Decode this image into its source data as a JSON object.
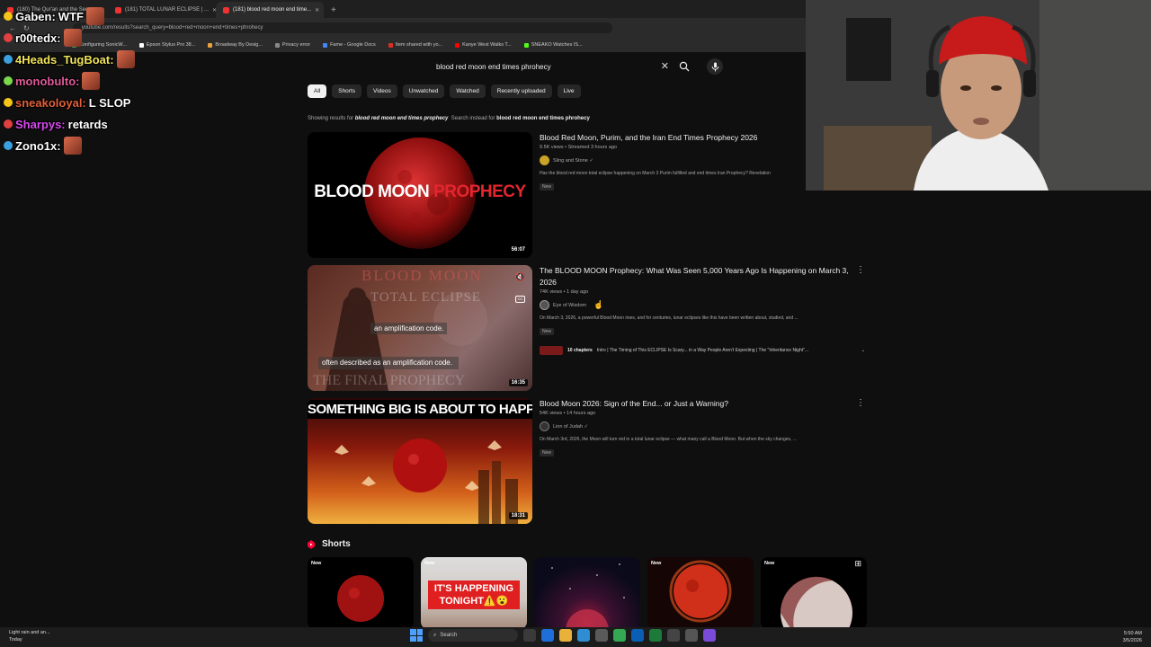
{
  "browser": {
    "tabs": [
      {
        "label": "(180) The Qur'an and the Sec..."
      },
      {
        "label": "(181) TOTAL LUNAR ECLIPSE | ..."
      },
      {
        "label": "(181) blood red moon end time..."
      }
    ],
    "new_tab": "+",
    "url": "youtube.com/results?search_query=blood+red+moon+end+times+phrohecy",
    "bookmarks": [
      {
        "label": "Configuring SonicW...",
        "color": "#2da44e"
      },
      {
        "label": "Epson Stylus Pro 38...",
        "color": "#ffffff"
      },
      {
        "label": "Broadway By Desig...",
        "color": "#e8a23b"
      },
      {
        "label": "Privacy error",
        "color": "#888888"
      },
      {
        "label": "Fame - Google Docs",
        "color": "#4285f4"
      },
      {
        "label": "Item shared with yo...",
        "color": "#d93025"
      },
      {
        "label": "Kanye West Walks T...",
        "color": "#ff0000"
      },
      {
        "label": "SNEAKO Watches IS...",
        "color": "#53fc18"
      }
    ]
  },
  "youtube": {
    "search_value": "blood red moon end times phrohecy",
    "clear_glyph": "✕",
    "chips": [
      "All",
      "Shorts",
      "Videos",
      "Unwatched",
      "Watched",
      "Recently uploaded",
      "Live"
    ],
    "showing_prefix": "Showing results for",
    "showing_query": "blood red moon end times prophecy",
    "instead_prefix": "Search instead for",
    "instead_query": "blood red moon end times phrohecy",
    "results": [
      {
        "title": "Blood Red Moon, Purim, and the Iran End Times Prophecy 2026",
        "meta": "9.5K views • Streamed 3 hours ago",
        "channel": "Sling and Stone ✓",
        "description": "Has the blood red moon total eclipse happening on March 3 Purim fulfilled and end times Iran Prophecy? Revelation",
        "badge": "New",
        "duration": "56:07",
        "thumb_text_1": "BLOOD MOON",
        "thumb_text_2": "PROPHECY"
      },
      {
        "title": "The BLOOD MOON Prophecy: What Was Seen 5,000 Years Ago Is Happening on March 3, 2026",
        "meta": "74K views • 1 day ago",
        "channel": "Eye of Wisdom",
        "description": "On March 3, 2026, a powerful Blood Moon rises, and for centuries, lunar eclipses like this have been written about, studied, and ...",
        "badge": "New",
        "duration": "16:35",
        "caption_1": "an amplification code.",
        "caption_2": "often described as an amplification code.",
        "chapters_label": "10 chapters",
        "chapters_text": "Intro | The Timing of This ECLIPSE Is Scary... in a Way People Aren't Expecting | The \"Inheritance Night\"...",
        "thumb_overlay_1": "TOTAL ECLIPSE",
        "thumb_overlay_2": "THE FINAL PROPHECY",
        "thumb_overlay_3": "BLOOD MOON"
      },
      {
        "title": "Blood Moon 2026: Sign of the End... or Just a Warning?",
        "meta": "54K views • 14 hours ago",
        "channel": "Lion of Judah ✓",
        "description": "On March 3rd, 2026, the Moon will turn red in a total lunar eclipse — what many call a Blood Moon. But when the sky changes, ...",
        "badge": "New",
        "duration": "18:31",
        "thumb_text": "SOMETHING BIG IS ABOUT TO HAPPEN."
      }
    ],
    "shorts_heading": "Shorts",
    "shorts": [
      {
        "badge": "New"
      },
      {
        "badge": "New",
        "text_1": "IT'S HAPPENING",
        "text_2": "TONIGHT⚠️😮"
      },
      {
        "badge": ""
      },
      {
        "badge": "New"
      },
      {
        "badge": "New"
      }
    ],
    "kebab": "⋮"
  },
  "chat": [
    {
      "user": "Gaben:",
      "message": "WTF",
      "user_color": "#ffffff"
    },
    {
      "user": "r00tedx:",
      "message": "",
      "user_color": "#ffffff"
    },
    {
      "user": "4Heads_TugBoat:",
      "message": "",
      "user_color": "#f0e35a"
    },
    {
      "user": "monobulto:",
      "message": "",
      "user_color": "#e05a9a"
    },
    {
      "user": "sneakoloyal:",
      "message": "L SLOP",
      "user_color": "#e0603a"
    },
    {
      "user": "Sharpys:",
      "message": "retards",
      "user_color": "#d94af0"
    },
    {
      "user": "Zono1x:",
      "message": "",
      "user_color": "#ffffff"
    }
  ],
  "taskbar": {
    "weather_1": "Light rain and an...",
    "weather_2": "Today",
    "search": "Search",
    "time": "5:50 AM",
    "date": "3/5/2026"
  }
}
